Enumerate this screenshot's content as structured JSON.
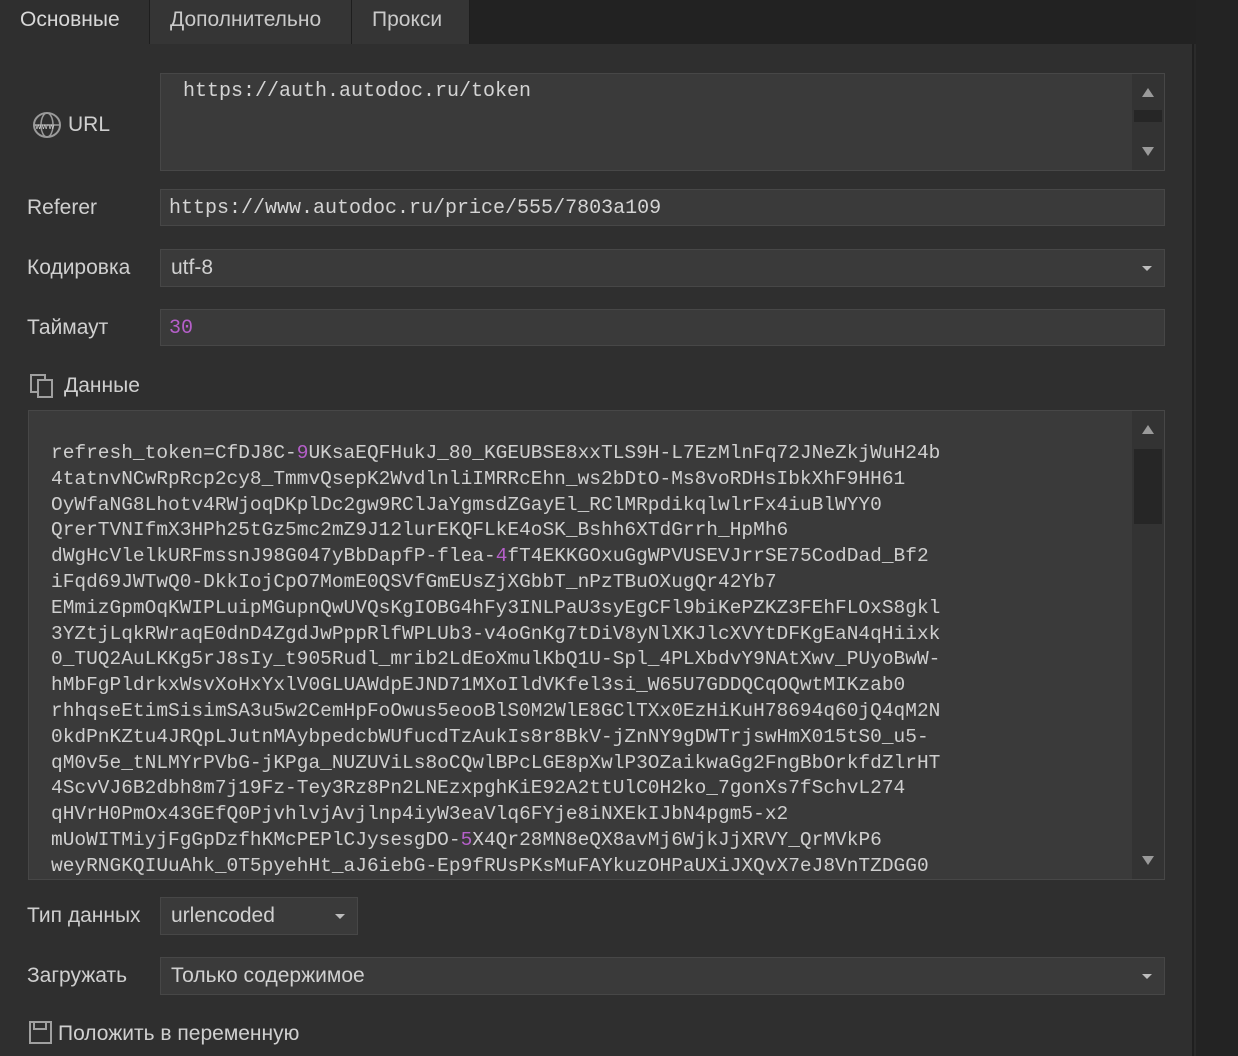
{
  "tabs": [
    "Основные",
    "Дополнительно",
    "Прокси"
  ],
  "url": {
    "label": "URL",
    "value": "https://auth.autodoc.ru/token"
  },
  "referer": {
    "label": "Referer",
    "value": "https://www.autodoc.ru/price/555/7803a109"
  },
  "encoding": {
    "label": "Кодировка",
    "value": "utf-8"
  },
  "timeout": {
    "label": "Таймаут",
    "value": "30"
  },
  "data_section": {
    "label": "Данные",
    "lines": [
      "refresh_token=CfDJ8C-9UKsaEQFHukJ_80_KGEUBSE8xxTLS9H-L7EzMlnFq72JNeZkjWuH24b",
      "4tatnvNCwRpRcp2cy8_TmmvQsepK2WvdlnliIMRRcEhn_ws2bDtO-Ms8voRDHsIbkXhF9HH61",
      "OyWfaNG8Lhotv4RWjoqDKplDc2gw9RClJaYgmsdZGayEl_RClMRpdikqlwlrFx4iuBlWYY0",
      "QrerTVNIfmX3HPh25tGz5mc2mZ9J12lurEKQFLkE4oSK_Bshh6XTdGrrh_HpMh6",
      "dWgHcVlelkURFmssnJ98G047yBbDapfP-flea-4fT4EKKGOxuGgWPVUSEVJrrSE75CodDad_Bf2",
      "iFqd69JWTwQ0-DkkIojCpO7MomE0QSVfGmEUsZjXGbbT_nPzTBuOXugQr42Yb7",
      "EMmizGpmOqKWIPLuipMGupnQwUVQsKgIOBG4hFy3INLPaU3syEgCFl9biKePZKZ3FEhFLOxS8gkl",
      "3YZtjLqkRWraqE0dnD4ZgdJwPppRlfWPLUb3-v4oGnKg7tDiV8yNlXKJlcXVYtDFKgEaN4qHiixk",
      "0_TUQ2AuLKKg5rJ8sIy_t905Rudl_mrib2LdEoXmulKbQ1U-Spl_4PLXbdvY9NAtXwv_PUyoBwW-",
      "hMbFgPldrkxWsvXoHxYxlV0GLUAWdpEJND71MXoIldVKfel3si_W65U7GDDQCqOQwtMIKzab0",
      "rhhqseEtimSisimSA3u5w2CemHpFoOwus5eooBlS0M2WlE8GClTXx0EzHiKuH78694q60jQ4qM2N",
      "0kdPnKZtu4JRQpLJutnMAybpedcbWUfucdTzAukIs8r8BkV-jZnNY9gDWTrjswHmX015tS0_u5-",
      "qM0v5e_tNLMYrPVbG-jKPga_NUZUViLs8oCQwlBPcLGE8pXwlP3OZaikwaGg2FngBbOrkfdZlrHT",
      "4ScvVJ6B2dbh8m7j19Fz-Tey3Rz8Pn2LNEzxpghKiE92A2ttUlC0H2ko_7gonXs7fSchvL274",
      "qHVrH0PmOx43GEfQ0PjvhlvjAvjlnp4iyW3eaVlq6FYje8iNXEkIJbN4pgm5-x2",
      "mUoWITMiyjFgGpDzfhKMcPEPlCJysesgDO-5X4Qr28MN8eQX8avMj6WjkJjXRVY_QrMVkP6",
      "weyRNGKQIUuAhk_0T5pyehHt_aJ6iebG-Ep9fRUsPKsMuFAYkuzOHPaUXiJXQvX7eJ8VnTZDGG0"
    ]
  },
  "data_type": {
    "label": "Тип данных",
    "value": "urlencoded"
  },
  "load": {
    "label": "Загружать",
    "value": "Только содержимое"
  },
  "save_var": {
    "label": "Положить в переменную"
  },
  "colors": {
    "background": "#2f2f2f",
    "field": "#3a3a3a",
    "number": "#b55fc9"
  }
}
